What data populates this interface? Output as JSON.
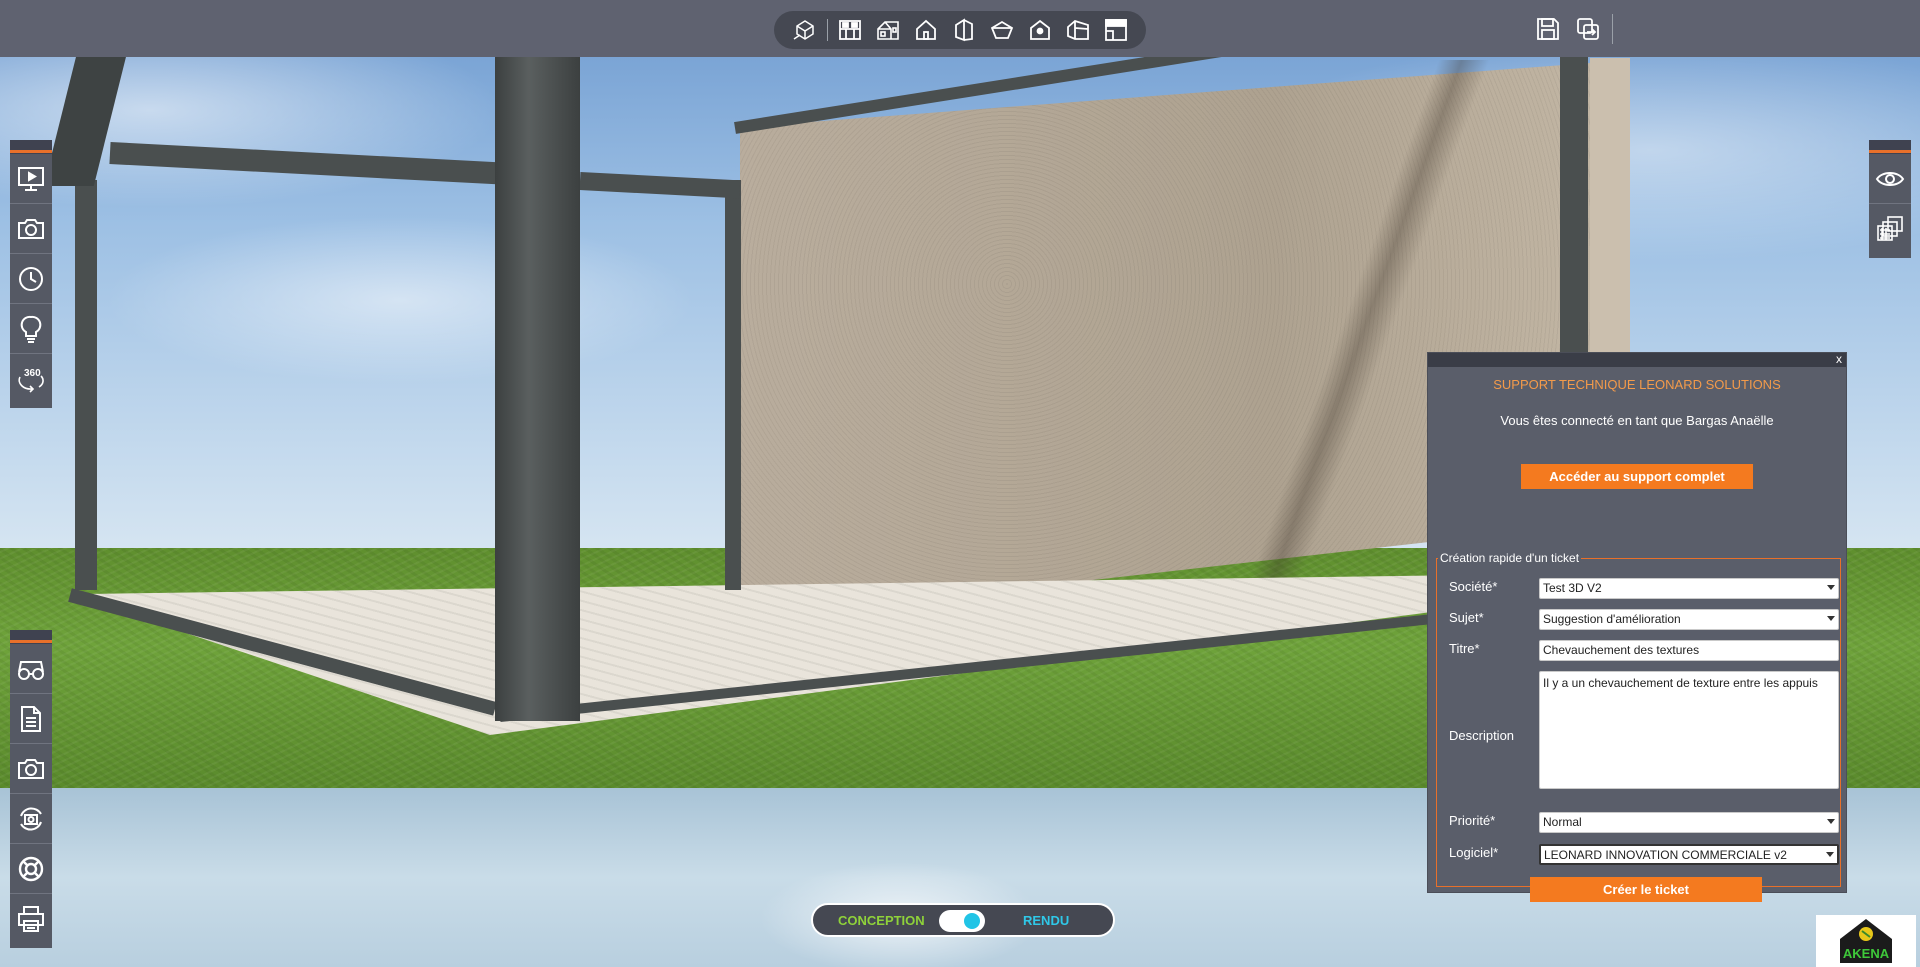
{
  "toolbar": {
    "view_icons": [
      "3d-view-icon",
      "plan-view-icon",
      "house-perspective-icon",
      "house-front-icon",
      "house-side-icon",
      "roof-top-icon",
      "house-point-icon",
      "house-open-icon",
      "section-view-icon"
    ],
    "right_icons": [
      "save-icon",
      "export-icon"
    ]
  },
  "left_toolbar_top": [
    "presentation-icon",
    "camera-icon",
    "clock-icon",
    "lightbulb-icon",
    "rotate-360-icon"
  ],
  "left_toolbar_bottom": [
    "glasses-icon",
    "document-icon",
    "camera-icon",
    "photo-rotate-icon",
    "lifebuoy-icon",
    "printer-icon"
  ],
  "right_toolbar": [
    "eye-icon",
    "layers-icon"
  ],
  "support": {
    "close_label": "x",
    "title": "SUPPORT TECHNIQUE LEONARD SOLUTIONS",
    "connected_text": "Vous êtes connecté en tant que Bargas Anaëlle",
    "full_support_button": "Accéder au support complet",
    "legend": "Création rapide d'un ticket",
    "societe_label": "Société*",
    "societe_value": "Test 3D V2",
    "sujet_label": "Sujet*",
    "sujet_value": "Suggestion d'amélioration",
    "titre_label": "Titre*",
    "titre_value": "Chevauchement des textures",
    "description_label": "Description",
    "description_value": "Il y a un chevauchement de texture entre les appuis",
    "priorite_label": "Priorité*",
    "priorite_value": "Normal",
    "logiciel_label": "Logiciel*",
    "logiciel_value": "LEONARD INNOVATION COMMERCIALE v2",
    "create_button": "Créer le ticket"
  },
  "mode": {
    "conception": "CONCEPTION",
    "rendu": "RENDU",
    "active": "rendu"
  },
  "logo": {
    "text": "AKENA"
  },
  "colors": {
    "accent": "#f47a1f",
    "conception": "#8fd23a",
    "rendu": "#2fc8e8"
  }
}
